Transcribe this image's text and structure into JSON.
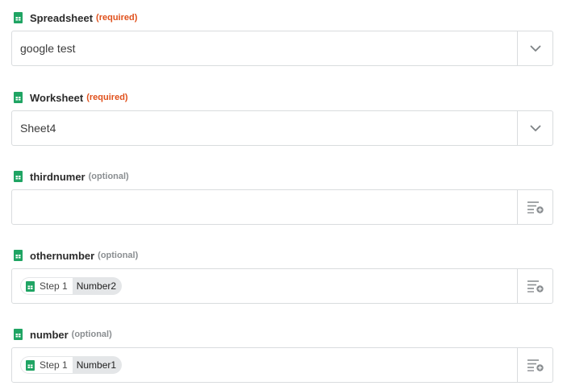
{
  "fields": [
    {
      "label": "Spreadsheet",
      "tag": "(required)",
      "tag_kind": "required",
      "value": "google test",
      "action_icon": "chevron-down-icon"
    },
    {
      "label": "Worksheet",
      "tag": "(required)",
      "tag_kind": "required",
      "value": "Sheet4",
      "action_icon": "chevron-down-icon"
    },
    {
      "label": "thirdnumer",
      "tag": "(optional)",
      "tag_kind": "optional",
      "value": "",
      "action_icon": "insert-data-icon"
    },
    {
      "label": "othernumber",
      "tag": "(optional)",
      "tag_kind": "optional",
      "pill": {
        "step": "Step 1",
        "field": "Number2"
      },
      "action_icon": "insert-data-icon"
    },
    {
      "label": "number",
      "tag": "(optional)",
      "tag_kind": "optional",
      "pill": {
        "step": "Step 1",
        "field": "Number1"
      },
      "action_icon": "insert-data-icon"
    }
  ],
  "colors": {
    "sheets_green": "#1fa463",
    "required": "#e0501b",
    "optional": "#8a8e91",
    "border": "#d9dcde",
    "pill_bg": "#e4e6e8"
  },
  "icons": {
    "field_icon": "google-sheets-icon",
    "pill_icon": "google-sheets-icon"
  }
}
